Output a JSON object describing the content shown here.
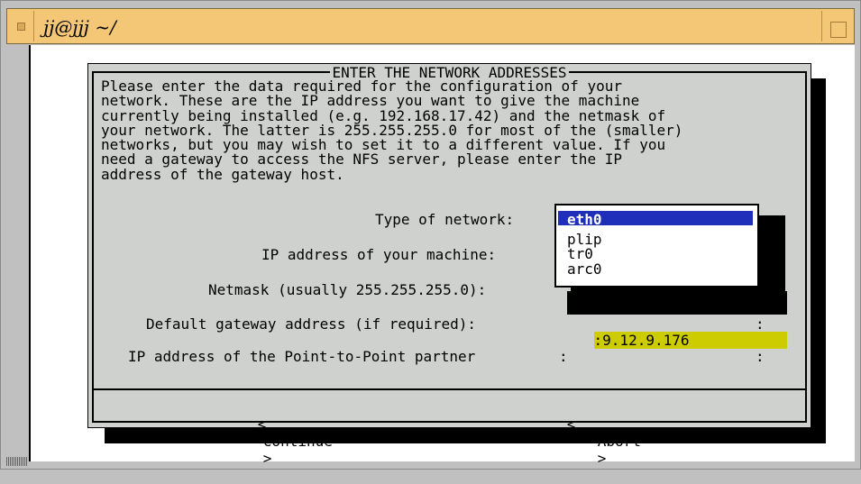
{
  "window": {
    "title": "jj@jjj ~/"
  },
  "dialog": {
    "title": "ENTER THE NETWORK ADDRESSES",
    "description": "Please enter the data required for the configuration of your\nnetwork. These are the IP address you want to give the machine\ncurrently being installed (e.g. 192.168.17.42) and the netmask of\nyour network. The latter is 255.255.255.0 for most of the (smaller)\nnetworks, but you may wish to set it to a different value. If you\nneed a gateway to access the NFS server, please enter the IP\naddress of the gateway host.",
    "fields": [
      {
        "label": "Type of network:"
      },
      {
        "label": "IP address of your machine:"
      },
      {
        "label": "Netmask (usually 255.255.255.0):"
      },
      {
        "label": "Default gateway address (if required):",
        "value": ":9.12.9.176"
      },
      {
        "label": "IP address of the Point-to-Point partner",
        "value": ":"
      }
    ],
    "field_end_colon": ":",
    "network_options": [
      "eth0",
      "plip",
      "tr0",
      "arc0"
    ],
    "selected_option": "eth0",
    "buttons": {
      "continue_left": "<",
      "continue": "Continue",
      "continue_right": ">",
      "abort_left": "<",
      "abort": "Abort",
      "abort_right": ">"
    }
  },
  "colors": {
    "titlebar": "#f3c776",
    "dialog_bg": "#cfd1cf",
    "selection": "#1f2fb9",
    "highlight": "#cdcc00"
  }
}
